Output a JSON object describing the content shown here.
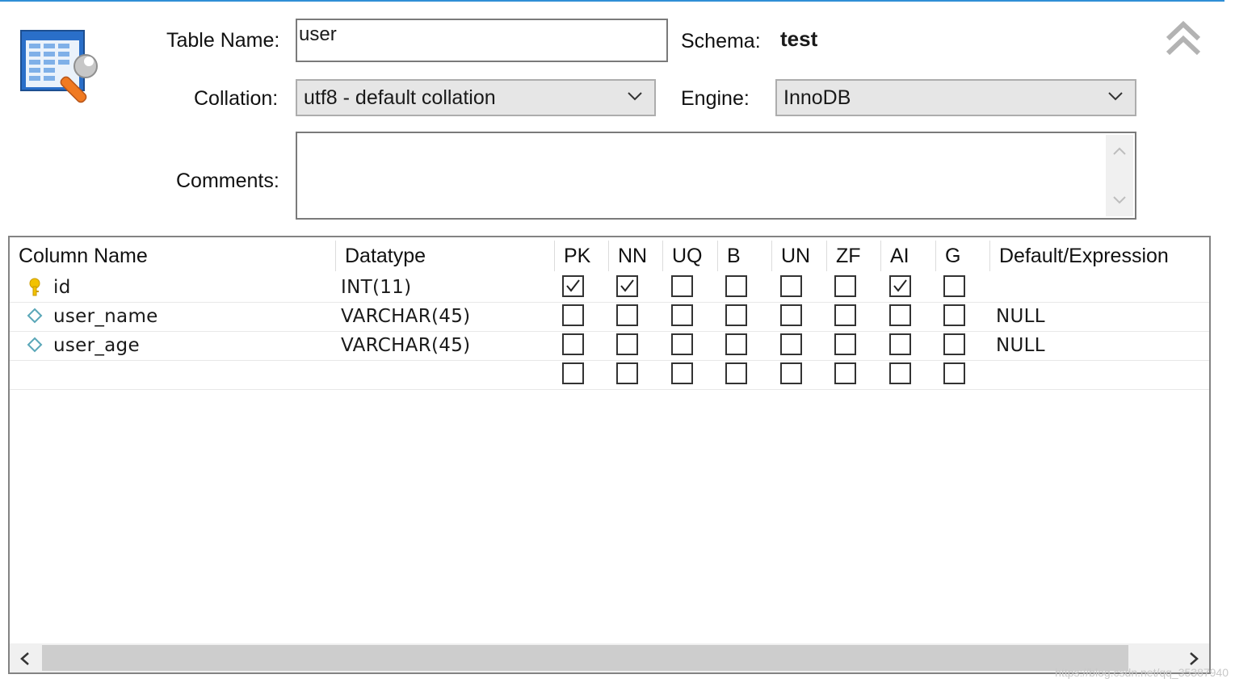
{
  "form": {
    "table_name_label": "Table Name:",
    "table_name_value": "user",
    "schema_label": "Schema:",
    "schema_value": "test",
    "collation_label": "Collation:",
    "collation_value": "utf8 - default collation",
    "engine_label": "Engine:",
    "engine_value": "InnoDB",
    "comments_label": "Comments:",
    "comments_value": ""
  },
  "grid": {
    "headers": {
      "column_name": "Column Name",
      "datatype": "Datatype",
      "pk": "PK",
      "nn": "NN",
      "uq": "UQ",
      "b": "B",
      "un": "UN",
      "zf": "ZF",
      "ai": "AI",
      "g": "G",
      "default": "Default/Expression"
    },
    "rows": [
      {
        "name": "id",
        "datatype": "INT(11)",
        "icon": "primary-key-icon",
        "flags": {
          "pk": true,
          "nn": true,
          "uq": false,
          "b": false,
          "un": false,
          "zf": false,
          "ai": true,
          "g": false
        },
        "default": ""
      },
      {
        "name": "user_name",
        "datatype": "VARCHAR(45)",
        "icon": "column-diamond-icon",
        "flags": {
          "pk": false,
          "nn": false,
          "uq": false,
          "b": false,
          "un": false,
          "zf": false,
          "ai": false,
          "g": false
        },
        "default": "NULL"
      },
      {
        "name": "user_age",
        "datatype": "VARCHAR(45)",
        "icon": "column-diamond-icon",
        "flags": {
          "pk": false,
          "nn": false,
          "uq": false,
          "b": false,
          "un": false,
          "zf": false,
          "ai": false,
          "g": false
        },
        "default": "NULL"
      },
      {
        "name": "",
        "datatype": "",
        "icon": "",
        "flags": {
          "pk": false,
          "nn": false,
          "uq": false,
          "b": false,
          "un": false,
          "zf": false,
          "ai": false,
          "g": false
        },
        "default": ""
      }
    ]
  },
  "watermark": "https://blog.csdn.net/qq_35387940",
  "colors": {
    "accent": "#2f8fd6",
    "key": "#f2c200",
    "icon_orange": "#e8731e"
  }
}
